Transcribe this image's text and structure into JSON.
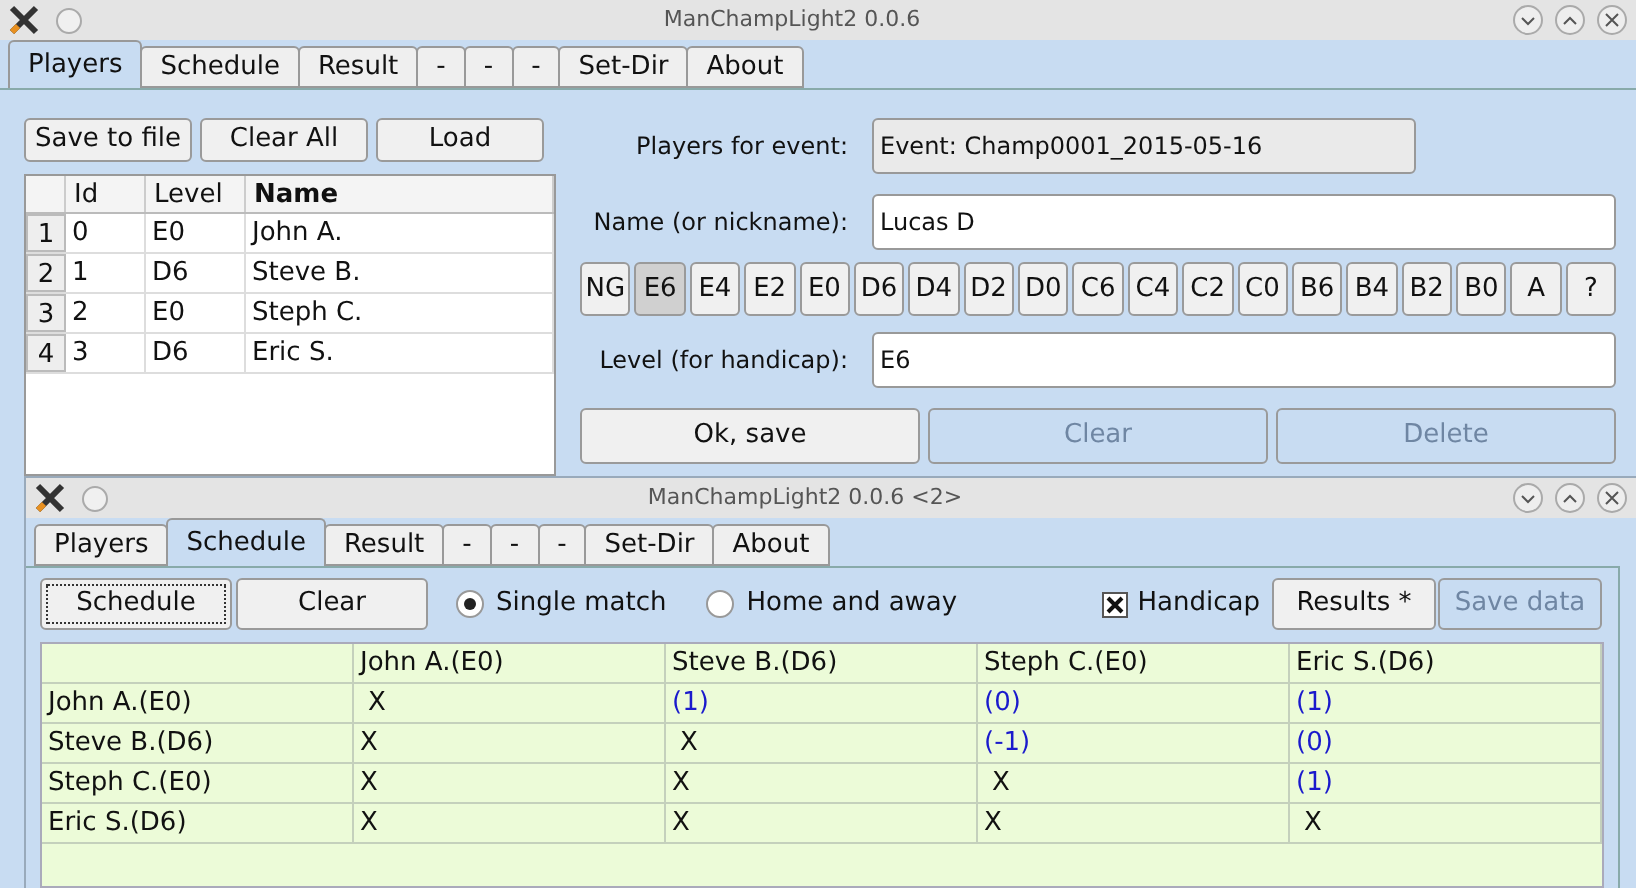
{
  "main_window": {
    "title": "ManChampLight2 0.0.6",
    "tabs": [
      {
        "label": "Players",
        "selected": true
      },
      {
        "label": "Schedule",
        "selected": false
      },
      {
        "label": "Result",
        "selected": false
      },
      {
        "label": "-",
        "selected": false
      },
      {
        "label": "-",
        "selected": false
      },
      {
        "label": "-",
        "selected": false
      },
      {
        "label": "Set-Dir",
        "selected": false
      },
      {
        "label": "About",
        "selected": false
      }
    ],
    "toolbar": [
      "Save to file",
      "Clear All",
      "Load"
    ],
    "players_table": {
      "columns": [
        "Id",
        "Level",
        "Name"
      ],
      "rows": [
        {
          "number": "1",
          "cells": [
            "0",
            "E0",
            "John A."
          ]
        },
        {
          "number": "2",
          "cells": [
            "1",
            "D6",
            "Steve B."
          ]
        },
        {
          "number": "3",
          "cells": [
            "2",
            "E0",
            "Steph C."
          ]
        },
        {
          "number": "4",
          "cells": [
            "3",
            "D6",
            "Eric S."
          ]
        }
      ]
    },
    "event_label": "Players for event:",
    "event_value": "Event: Champ0001_2015-05-16",
    "name_label": "Name (or nickname):",
    "name_value": "Lucas D",
    "levels": [
      {
        "label": "NG",
        "selected": false
      },
      {
        "label": "E6",
        "selected": true
      },
      {
        "label": "E4",
        "selected": false
      },
      {
        "label": "E2",
        "selected": false
      },
      {
        "label": "E0",
        "selected": false
      },
      {
        "label": "D6",
        "selected": false
      },
      {
        "label": "D4",
        "selected": false
      },
      {
        "label": "D2",
        "selected": false
      },
      {
        "label": "D0",
        "selected": false
      },
      {
        "label": "C6",
        "selected": false
      },
      {
        "label": "C4",
        "selected": false
      },
      {
        "label": "C2",
        "selected": false
      },
      {
        "label": "C0",
        "selected": false
      },
      {
        "label": "B6",
        "selected": false
      },
      {
        "label": "B4",
        "selected": false
      },
      {
        "label": "B2",
        "selected": false
      },
      {
        "label": "B0",
        "selected": false
      },
      {
        "label": "A",
        "selected": false
      },
      {
        "label": "?",
        "selected": false
      }
    ],
    "level_label": "Level (for handicap):",
    "level_value": "E6",
    "actions": [
      {
        "label": "Ok, save",
        "disabled": false
      },
      {
        "label": "Clear",
        "disabled": true
      },
      {
        "label": "Delete",
        "disabled": true
      }
    ]
  },
  "second_window": {
    "title": "ManChampLight2 0.0.6 <2>",
    "tabs": [
      {
        "label": "Players",
        "selected": false
      },
      {
        "label": "Schedule",
        "selected": true
      },
      {
        "label": "Result",
        "selected": false
      },
      {
        "label": "-",
        "selected": false
      },
      {
        "label": "-",
        "selected": false
      },
      {
        "label": "-",
        "selected": false
      },
      {
        "label": "Set-Dir",
        "selected": false
      },
      {
        "label": "About",
        "selected": false
      }
    ],
    "buttons": [
      {
        "label": "Schedule",
        "focused": true
      },
      {
        "label": "Clear",
        "focused": false
      }
    ],
    "modes": [
      {
        "label": "Single match",
        "selected": true
      },
      {
        "label": "Home and away",
        "selected": false
      }
    ],
    "handicap": {
      "label": "Handicap",
      "checked": true
    },
    "result_buttons": [
      {
        "label": "Results *",
        "disabled": false
      },
      {
        "label": "Save data",
        "disabled": true
      }
    ],
    "schedule_table": {
      "columns": [
        "John A.(E0)",
        "Steve B.(D6)",
        "Steph C.(E0)",
        "Eric S.(D6)"
      ],
      "rows": [
        {
          "name": "John A.(E0)",
          "cells": [
            {
              "kind": "self",
              "text": "X"
            },
            {
              "kind": "score",
              "text": "(1)"
            },
            {
              "kind": "score",
              "text": "(0)"
            },
            {
              "kind": "score",
              "text": "(1)"
            }
          ]
        },
        {
          "name": "Steve B.(D6)",
          "cells": [
            {
              "kind": "played",
              "text": "X"
            },
            {
              "kind": "self",
              "text": "X"
            },
            {
              "kind": "score",
              "text": "(-1)"
            },
            {
              "kind": "score",
              "text": "(0)"
            }
          ]
        },
        {
          "name": "Steph C.(E0)",
          "cells": [
            {
              "kind": "played",
              "text": "X"
            },
            {
              "kind": "played",
              "text": "X"
            },
            {
              "kind": "self",
              "text": "X"
            },
            {
              "kind": "score",
              "text": "(1)"
            }
          ]
        },
        {
          "name": "Eric S.(D6)",
          "cells": [
            {
              "kind": "played",
              "text": "X"
            },
            {
              "kind": "played",
              "text": "X"
            },
            {
              "kind": "played",
              "text": "X"
            },
            {
              "kind": "self",
              "text": "X"
            }
          ]
        }
      ]
    }
  }
}
